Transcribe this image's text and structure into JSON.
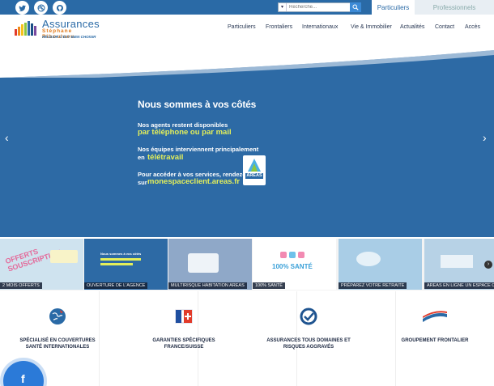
{
  "topbar": {
    "social": [
      "twitter-icon",
      "dribbble-icon",
      "github-icon"
    ],
    "search_placeholder": "Recherche...",
    "tabs": [
      "Particuliers",
      "Professionnels"
    ]
  },
  "logo": {
    "name": "Assurances",
    "sub": "Stéphane Piboulaeu",
    "tagline": "RÉUSSIR C'EST BIEN CHOISIR"
  },
  "nav": [
    "Particuliers",
    "Frontaliers",
    "Internationaux",
    "Vie & Immobilier",
    "Actualités",
    "Contact",
    "Accès"
  ],
  "hero": {
    "title": "Nous sommes à vos côtés",
    "l1": "Nos agents restent disponibles",
    "y1": "par téléphone ou par mail",
    "l2": "Nos équipes interviennent principalement",
    "l2b": "en",
    "y2": "télétravail",
    "l3": "Pour accéder à vos services, rendez-vous",
    "l3b": "sur",
    "y3": "monespaceclient.areas.fr",
    "badge": "AREAS"
  },
  "carousel": [
    {
      "caption": "2 MOIS OFFERTS",
      "text": "OFFERTS SOUSCRIPTION",
      "color": "#cfe3ef"
    },
    {
      "caption": "OUVERTURE DE L'AGENCE",
      "text": "Nous sommes à vos côtés",
      "color": "#2d6aa5"
    },
    {
      "caption": "MULTIRISQUE HABITATION AREAS",
      "text": "",
      "color": "#8fa8c8"
    },
    {
      "caption": "100% SANTÉ",
      "text": "100% SANTÉ",
      "color": "#ffffff"
    },
    {
      "caption": "PRÉPAREZ VOTRE RETRAITE",
      "text": "",
      "color": "#a9cde6"
    },
    {
      "caption": "AREAS EN LIGNE UN ESPACE CLIENT",
      "text": "",
      "color": "#b7d2e6"
    }
  ],
  "features": [
    {
      "label": "SPÉCIALISÉ EN COUVERTURES SANTÉ INTERNATIONALES",
      "icon": "globe-icon"
    },
    {
      "label": "GARANTIES SPÉCIFIQUES FRANCE/SUISSE",
      "icon": "flags-icon"
    },
    {
      "label": "ASSURANCES TOUS DOMAINES ET RISQUES AGGRAVÉS",
      "icon": "shield-check-icon"
    },
    {
      "label": "GROUPEMENT FRONTALIER",
      "icon": "frontalier-logo-icon"
    }
  ],
  "colors": {
    "brand": "#2a6aa6",
    "accent": "#e4ef5a",
    "orange": "#e07a1a"
  }
}
